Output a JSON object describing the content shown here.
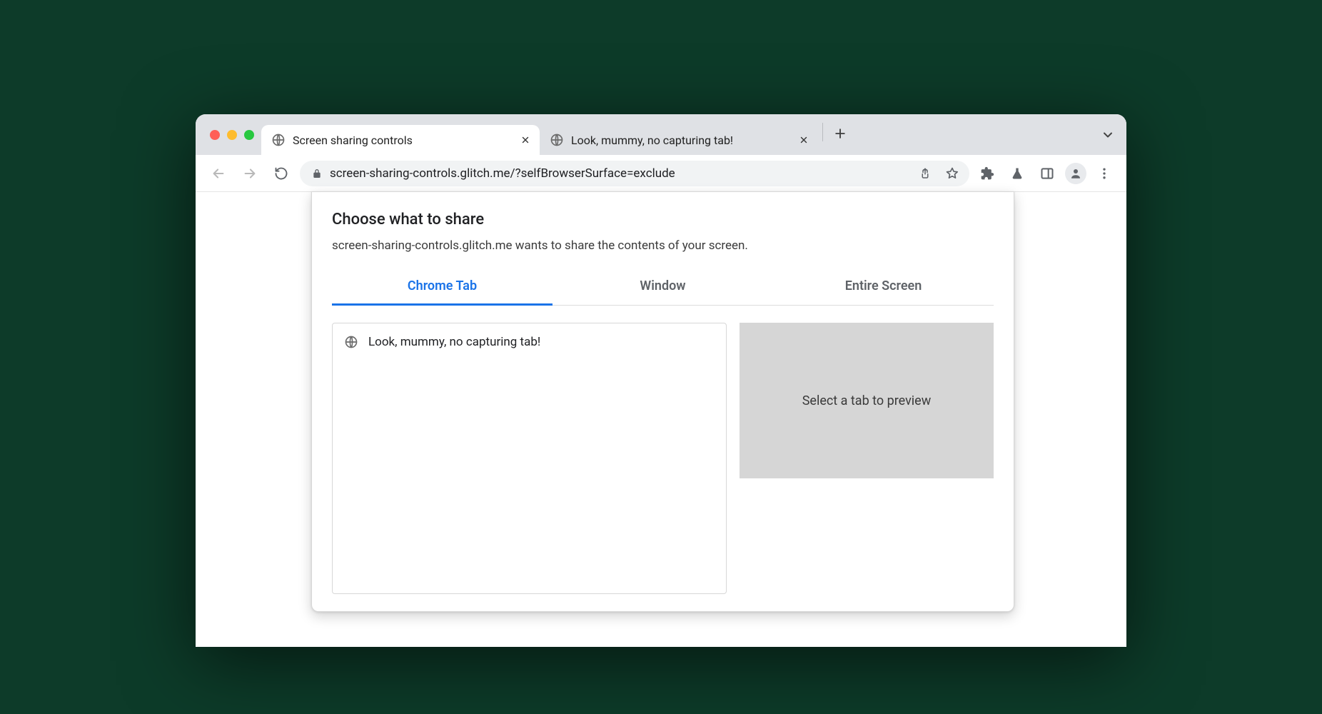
{
  "browser": {
    "tabs": [
      {
        "title": "Screen sharing controls",
        "active": true
      },
      {
        "title": "Look, mummy, no capturing tab!",
        "active": false
      }
    ],
    "url": "screen-sharing-controls.glitch.me/?selfBrowserSurface=exclude"
  },
  "dialog": {
    "title": "Choose what to share",
    "subtitle": "screen-sharing-controls.glitch.me wants to share the contents of your screen.",
    "tabs": {
      "chrome_tab": "Chrome Tab",
      "window": "Window",
      "entire_screen": "Entire Screen"
    },
    "tab_list": [
      {
        "title": "Look, mummy, no capturing tab!"
      }
    ],
    "preview_placeholder": "Select a tab to preview"
  },
  "colors": {
    "accent": "#1a73e8"
  }
}
